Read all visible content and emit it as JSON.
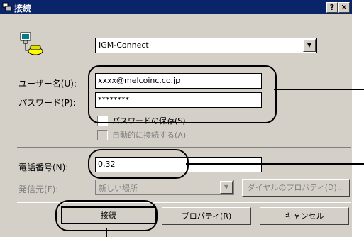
{
  "window": {
    "title": "接続",
    "help_label": "?",
    "close_label": "✕"
  },
  "connection": {
    "name": "IGM-Connect",
    "icon": "dialup-connection-icon"
  },
  "credentials": {
    "username_label": "ユーザー名(U):",
    "username_value": "xxxx@melcoinc.co.jp",
    "password_label": "パスワード(P):",
    "password_value": "********",
    "save_password_label": "パスワードの保存(S)",
    "auto_connect_label": "自動的に接続する(A)"
  },
  "dialing": {
    "phone_label": "電話番号(N):",
    "phone_value": "0,32",
    "dial_from_label": "発信元(F):",
    "dial_from_value": "新しい場所",
    "dial_properties_label": "ダイヤルのプロパティ(D)..."
  },
  "buttons": {
    "connect": "接続",
    "properties": "プロパティ(R)",
    "cancel": "キャンセル"
  }
}
